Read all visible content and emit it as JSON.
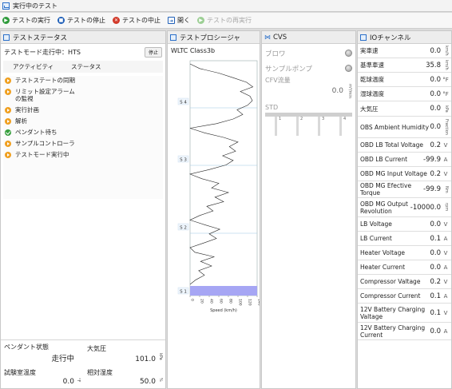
{
  "window": {
    "title": "実行中のテスト"
  },
  "toolbar": {
    "run": "テストの実行",
    "stop": "テストの停止",
    "abort": "テストの中止",
    "open": "開く",
    "rerun": "テストの再実行"
  },
  "status_panel": {
    "title": "テストステータス",
    "mode_text": "テストモード走行中：HTS",
    "stop_button": "停止",
    "col_activity": "アクティビティ",
    "col_status": "ステータス",
    "activities": [
      {
        "label": "テストステートの同期",
        "icon": "play-icon"
      },
      {
        "label": "リミット設定アラームの監視",
        "icon": "play-icon"
      },
      {
        "label": "実行計画",
        "icon": "play-icon"
      },
      {
        "label": "解析",
        "icon": "play-icon"
      },
      {
        "label": "ペンダント待ち",
        "icon": "check-icon"
      },
      {
        "label": "サンプルコントローラ",
        "icon": "play-icon"
      },
      {
        "label": "テストモード実行中",
        "icon": "play-icon"
      }
    ],
    "pendant_label": "ペンダント状態",
    "pendant_value": "走行中",
    "pressure_label": "大気圧",
    "pressure_value": "101.0",
    "pressure_unit": "kPa",
    "room_temp_label": "試験室温度",
    "room_temp_value": "0.0",
    "room_temp_unit": "°F",
    "humidity_label": "相対湿度",
    "humidity_value": "50.0",
    "humidity_unit": "%"
  },
  "procedure_panel": {
    "title": "テストプロシージャ",
    "cycle_name": "WLTC Class3b",
    "phase_markers": [
      "S 4",
      "S 3",
      "S 2",
      "S 1"
    ],
    "x_axis_label": "Speed (km/h)",
    "x_ticks": [
      "0",
      "20",
      "40",
      "60",
      "80",
      "100",
      "120",
      "140"
    ]
  },
  "cvs_panel": {
    "title": "CVS",
    "blower_label": "ブロワ",
    "pump_label": "サンプルポンプ",
    "cfv_label": "CFV流量",
    "cfv_value": "0.0",
    "cfv_unit": "m³/min",
    "std_label": "STD",
    "std_slots": [
      "1",
      "2",
      "3",
      "4"
    ]
  },
  "io_panel": {
    "title": "IOチャンネル",
    "channels": [
      {
        "name": "実車速",
        "value": "0.0",
        "unit": "km/h"
      },
      {
        "name": "基準車速",
        "value": "35.8",
        "unit": "km/h"
      },
      {
        "name": "乾球温度",
        "value": "0.0",
        "unit": "°F"
      },
      {
        "name": "湿球温度",
        "value": "0.0",
        "unit": "°F"
      },
      {
        "name": "大気圧",
        "value": "0.0",
        "unit": "kPa"
      },
      {
        "name": "OBS Ambient Humidity",
        "value": "0.0",
        "unit": "Fraction"
      },
      {
        "name": "OBD LB Total Voltage",
        "value": "0.2",
        "unit": "V"
      },
      {
        "name": "OBD LB Current",
        "value": "-99.9",
        "unit": "A"
      },
      {
        "name": "OBD MG Input Voltage",
        "value": "0.2",
        "unit": "V"
      },
      {
        "name": "OBD MG Efective Torque",
        "value": "-99.9",
        "unit": "Nm"
      },
      {
        "name": "OBD MG Output Revolution",
        "value": "-10000.0",
        "unit": "rpm"
      },
      {
        "name": "LB Voltage",
        "value": "0.0",
        "unit": "V"
      },
      {
        "name": "LB Current",
        "value": "0.1",
        "unit": "A"
      },
      {
        "name": "Heater Voltage",
        "value": "0.0",
        "unit": "V"
      },
      {
        "name": "Heater Current",
        "value": "0.0",
        "unit": "A"
      },
      {
        "name": "Compressor Valtage",
        "value": "0.2",
        "unit": "V"
      },
      {
        "name": "Compressor Current",
        "value": "0.1",
        "unit": "A"
      },
      {
        "name": "12V Battery Charging Valtage",
        "value": "0.1",
        "unit": "V"
      },
      {
        "name": "12V Battery Charging Current",
        "value": "0.0",
        "unit": "A"
      }
    ]
  },
  "chart_data": {
    "type": "line",
    "title": "WLTC Class3b",
    "xlabel": "Speed (km/h)",
    "ylabel": "",
    "xlim": [
      0,
      140
    ],
    "orientation": "vertical-time",
    "phases": [
      "S 1",
      "S 2",
      "S 3",
      "S 4"
    ],
    "series": [
      {
        "values": [
          0,
          12,
          30,
          18,
          45,
          22,
          50,
          10,
          0,
          28,
          55,
          40,
          62,
          30,
          0,
          20,
          48,
          35,
          70,
          52,
          80,
          45,
          60,
          25,
          0,
          40,
          75,
          90,
          68,
          95,
          82,
          100,
          70,
          30,
          0,
          55,
          90,
          110,
          98,
          120,
          130,
          125,
          105,
          131,
          118,
          90,
          60,
          20,
          0
        ]
      }
    ]
  }
}
